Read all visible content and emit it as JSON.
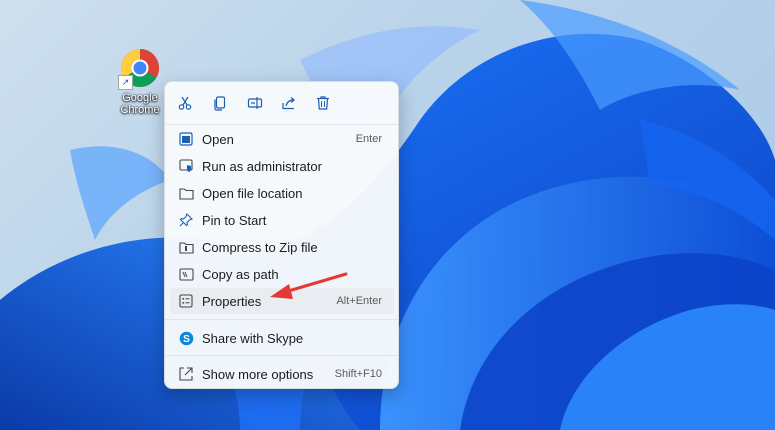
{
  "desktop": {
    "icon_label": "Google Chrome",
    "icon_label_line1": "Google",
    "icon_label_line2": "Chrome"
  },
  "context_menu": {
    "quick_actions": [
      "cut-icon",
      "copy-icon",
      "rename-icon",
      "share-icon",
      "delete-icon"
    ],
    "items": [
      {
        "label": "Open",
        "shortcut": "Enter",
        "icon": "open-icon"
      },
      {
        "label": "Run as administrator",
        "shortcut": "",
        "icon": "shield-icon"
      },
      {
        "label": "Open file location",
        "shortcut": "",
        "icon": "folder-icon"
      },
      {
        "label": "Pin to Start",
        "shortcut": "",
        "icon": "pin-icon"
      },
      {
        "label": "Compress to Zip file",
        "shortcut": "",
        "icon": "zip-icon"
      },
      {
        "label": "Copy as path",
        "shortcut": "",
        "icon": "path-icon"
      },
      {
        "label": "Properties",
        "shortcut": "Alt+Enter",
        "icon": "properties-icon"
      },
      {
        "label": "Share with Skype",
        "shortcut": "",
        "icon": "skype-icon"
      },
      {
        "label": "Show more options",
        "shortcut": "Shift+F10",
        "icon": "more-options-icon"
      }
    ]
  },
  "colors": {
    "accent": "#0a5fd8",
    "annotation_arrow": "#e53935"
  }
}
